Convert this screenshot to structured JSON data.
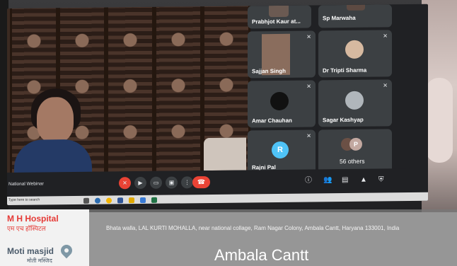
{
  "meeting": {
    "title": "National Webinar",
    "participants": [
      {
        "name": "Prabhjot Kaur at..."
      },
      {
        "name": "Sp Marwaha"
      },
      {
        "name": "Sajjan Singh"
      },
      {
        "name": "Dr Tripti Sharma"
      },
      {
        "name": "Amar Chauhan"
      },
      {
        "name": "Sagar Kashyap"
      },
      {
        "name": "Rajni Pal",
        "initial": "R"
      }
    ],
    "others": {
      "label": "56 others",
      "initial": "P"
    }
  },
  "taskbar": {
    "search_placeholder": "Type here to search"
  },
  "overlay": {
    "hospital_en": "M H Hospital",
    "hospital_hi": "एम एच हॉस्पिटल",
    "mosque_en": "Moti masjid",
    "mosque_hi": "मोती मस्जिद",
    "address": "Bhata walla, LAL KURTI MOHALLA, near national collage, Ram Nagar Colony, Ambala Cantt, Haryana 133001, India",
    "city": "Ambala Cantt"
  },
  "colors": {
    "end_call": "#ea4335",
    "tile": "#3c4043",
    "rajni_avatar": "#4fc3f7",
    "others_avatar": "#c2a8a0",
    "pin": "#7f98a6"
  },
  "icons": {
    "mic": "mic-off-icon",
    "camera": "camera-icon",
    "captions": "captions-icon",
    "present": "present-icon",
    "more": "more-vert-icon",
    "hangup": "hangup-icon",
    "info": "info-icon",
    "people": "people-icon",
    "chat": "chat-icon",
    "activities": "activities-icon",
    "host": "shield-icon",
    "map_pin": "map-pin-icon"
  }
}
